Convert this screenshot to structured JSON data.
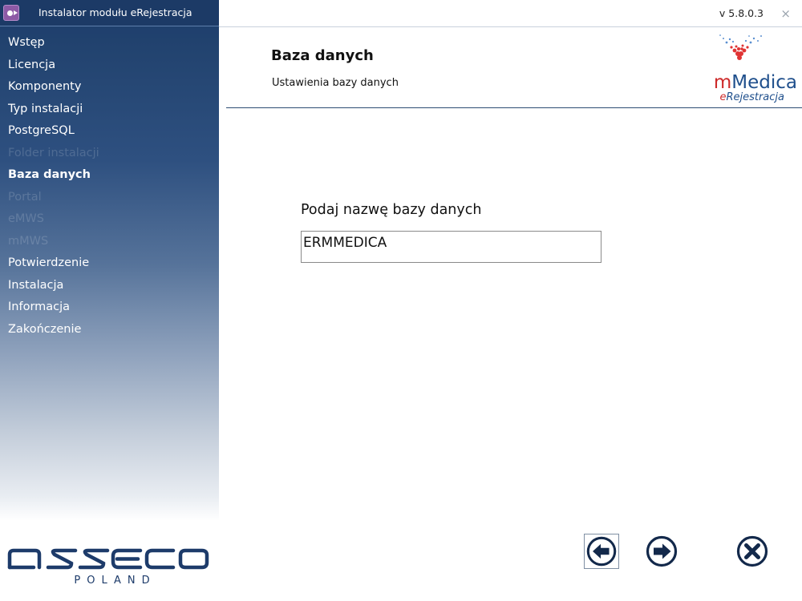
{
  "window": {
    "title": "Instalator modułu eRejestracja",
    "version": "v 5.8.0.3",
    "close_glyph": "×"
  },
  "sidebar": {
    "steps": [
      {
        "label": "Wstęp",
        "state": "done"
      },
      {
        "label": "Licencja",
        "state": "done"
      },
      {
        "label": "Komponenty",
        "state": "done"
      },
      {
        "label": "Typ instalacji",
        "state": "done"
      },
      {
        "label": "PostgreSQL",
        "state": "done"
      },
      {
        "label": "Folder instalacji",
        "state": "disabled"
      },
      {
        "label": "Baza danych",
        "state": "active"
      },
      {
        "label": "Portal",
        "state": "disabled"
      },
      {
        "label": "eMWS",
        "state": "disabled"
      },
      {
        "label": "mMWS",
        "state": "disabled"
      },
      {
        "label": "Potwierdzenie",
        "state": "pending"
      },
      {
        "label": "Instalacja",
        "state": "pending"
      },
      {
        "label": "Informacja",
        "state": "pending"
      },
      {
        "label": "Zakończenie",
        "state": "pending"
      }
    ],
    "brand": {
      "name": "asseco",
      "sub": "POLAND"
    }
  },
  "header": {
    "title": "Baza danych",
    "subtitle": "Ustawienia bazy danych",
    "logo": {
      "main_m": "m",
      "main_rest": "Medica",
      "sub_e": "e",
      "sub_rest": "Rejestracja"
    }
  },
  "form": {
    "db_label": "Podaj nazwę bazy danych",
    "db_value": "ERMMEDICA"
  },
  "colors": {
    "sidebar_dark": "#1b3b6b",
    "brand_blue": "#1f4f8c",
    "brand_red": "#cd2a2a"
  },
  "icons": {
    "back": "arrow-left-circle-icon",
    "next": "arrow-right-circle-icon",
    "cancel": "x-circle-icon"
  }
}
